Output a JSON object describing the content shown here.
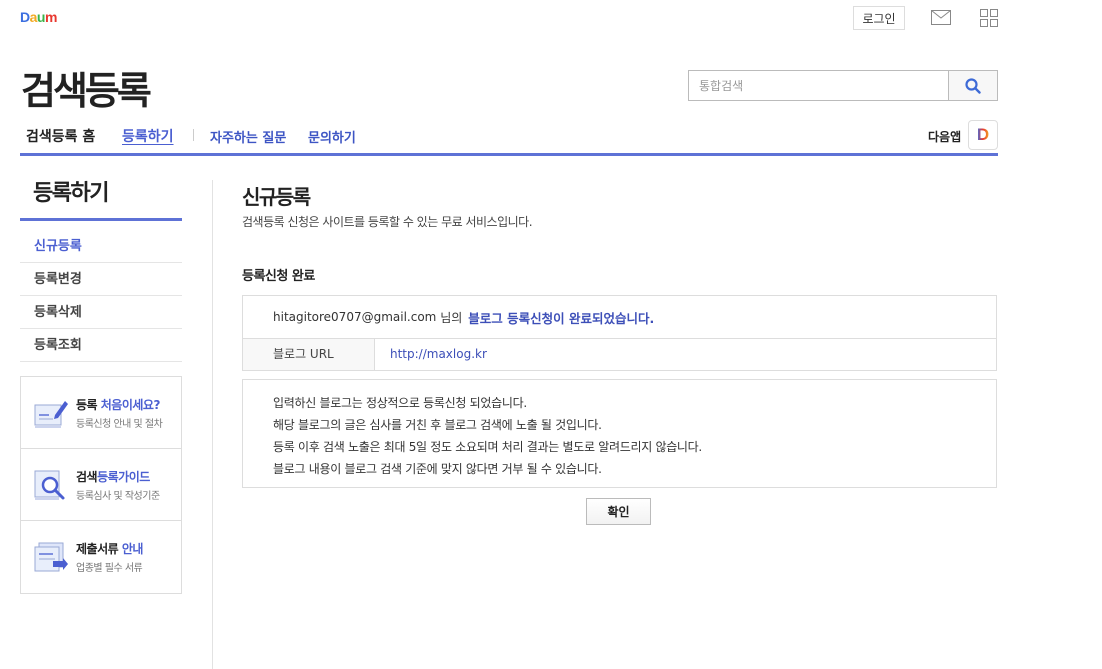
{
  "header": {
    "logo_letters": [
      {
        "char": "D",
        "color": "#3c6fe0"
      },
      {
        "char": "a",
        "color": "#f2a922"
      },
      {
        "char": "u",
        "color": "#3bb34a"
      },
      {
        "char": "m",
        "color": "#e8382f"
      }
    ],
    "login_label": "로그인",
    "mail_icon": "mail-icon",
    "apps_icon": "apps-grid-icon"
  },
  "service_title": "검색등록",
  "search": {
    "placeholder": "통합검색",
    "button_icon": "search-icon"
  },
  "gnb": {
    "items": [
      {
        "label": "검색등록 홈"
      },
      {
        "label": "등록하기",
        "active": true
      },
      {
        "label": "자주하는 질문"
      },
      {
        "label": "문의하기"
      }
    ],
    "daum_app_label": "다음앱",
    "daum_app_icon_letter": "D"
  },
  "sidebar": {
    "title": "등록하기",
    "menu": [
      {
        "label": "신규등록",
        "active": true
      },
      {
        "label": "등록변경"
      },
      {
        "label": "등록삭제"
      },
      {
        "label": "등록조회"
      }
    ],
    "banners": [
      {
        "title_plain": "등록 ",
        "title_hl": "처음이세요?",
        "sub": "등록신청 안내 및 절차",
        "icon": "pencil-doc-icon"
      },
      {
        "title_plain": "검색",
        "title_hl": "등록가이드",
        "sub": "등록심사 및 작성기준",
        "icon": "magnifier-doc-icon"
      },
      {
        "title_plain": "제출서류 ",
        "title_hl": "안내",
        "sub": "업종별 필수 서류",
        "icon": "doc-stack-icon"
      }
    ]
  },
  "content": {
    "title": "신규등록",
    "desc": "검색등록 신청은 사이트를 등록할 수 있는 무료 서비스입니다.",
    "section_title": "등록신청 완료",
    "result": {
      "email": "hitagitore0707@gmail.com",
      "suffix": "님의",
      "done_message": "블로그 등록신청이 완료되었습니다.",
      "url_label": "블로그 URL",
      "url_value": "http://maxlog.kr"
    },
    "notice_lines": [
      "입력하신 블로그는 정상적으로 등록신청 되었습니다.",
      "해당 블로그의 글은 심사를 거친 후 블로그 검색에 노출 될 것입니다.",
      "등록 이후 검색 노출은 최대 5일 정도 소요되며 처리 결과는 별도로 알려드리지 않습니다.",
      "블로그 내용이 블로그 검색 기준에 맞지 않다면 거부 될 수 있습니다."
    ],
    "ok_label": "확인"
  },
  "colors": {
    "accent": "#5e72d6",
    "link": "#3d4fb8"
  }
}
